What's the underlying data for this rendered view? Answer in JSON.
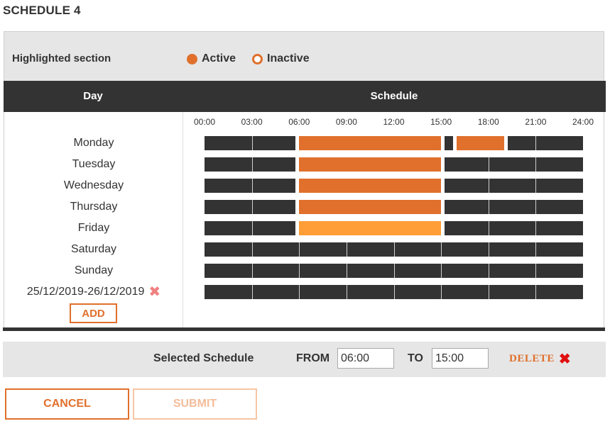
{
  "page": {
    "title": "SCHEDULE 4"
  },
  "legend": {
    "label": "Highlighted section",
    "active_label": "Active",
    "inactive_label": "Inactive"
  },
  "table": {
    "day_header": "Day",
    "schedule_header": "Schedule",
    "time_labels": [
      "00:00",
      "03:00",
      "06:00",
      "09:00",
      "12:00",
      "15:00",
      "18:00",
      "21:00",
      "24:00"
    ],
    "rows": [
      {
        "label": "Monday",
        "segments": [
          {
            "from": "06:00",
            "to": "15:00",
            "state": "active"
          },
          {
            "from": "16:00",
            "to": "19:00",
            "state": "active"
          }
        ]
      },
      {
        "label": "Tuesday",
        "segments": [
          {
            "from": "06:00",
            "to": "15:00",
            "state": "active"
          }
        ]
      },
      {
        "label": "Wednesday",
        "segments": [
          {
            "from": "06:00",
            "to": "15:00",
            "state": "active"
          }
        ]
      },
      {
        "label": "Thursday",
        "segments": [
          {
            "from": "06:00",
            "to": "15:00",
            "state": "active"
          }
        ]
      },
      {
        "label": "Friday",
        "segments": [
          {
            "from": "06:00",
            "to": "15:00",
            "state": "selected"
          }
        ]
      },
      {
        "label": "Saturday",
        "segments": []
      },
      {
        "label": "Sunday",
        "segments": []
      },
      {
        "label": "25/12/2019-26/12/2019",
        "segments": [],
        "removable": true
      }
    ],
    "add_label": "ADD"
  },
  "selected": {
    "label": "Selected Schedule",
    "from_label": "FROM",
    "from_value": "06:00",
    "to_label": "TO",
    "to_value": "15:00",
    "delete_label": "DELETE"
  },
  "buttons": {
    "cancel": "CANCEL",
    "submit": "SUBMIT"
  },
  "colors": {
    "accent": "#e0702c",
    "selected_segment": "#ff9d37",
    "track": "#333333",
    "header_bg": "#333333",
    "panel_bg": "#e6e6e6"
  },
  "icons": {
    "remove": "close-icon",
    "delete": "close-icon"
  }
}
